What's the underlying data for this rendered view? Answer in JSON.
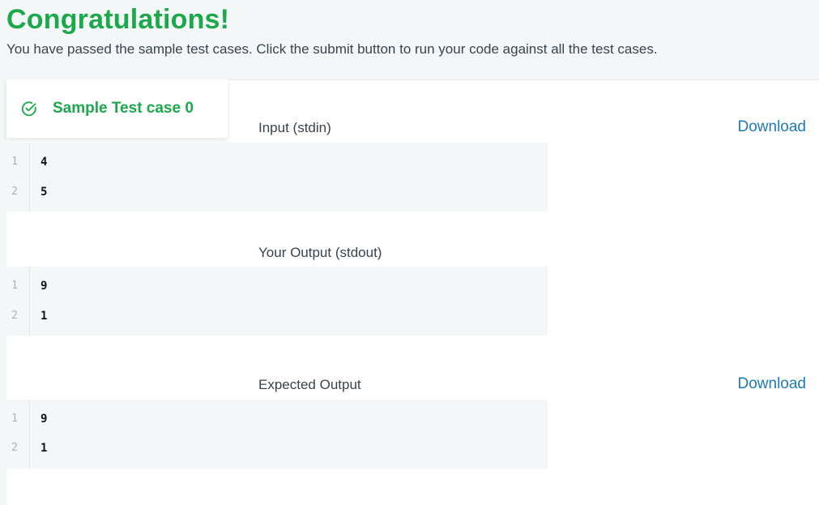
{
  "banner": {
    "title": "Congratulations!",
    "message": "You have passed the sample test cases. Click the submit button to run your code against all the test cases."
  },
  "colors": {
    "success": "#1ba94c",
    "link": "#1f7ab8",
    "text": "#39424e",
    "code_bg": "#f3f7f7"
  },
  "test_cases": [
    {
      "label": "Sample Test case 0",
      "status_icon": "check-circle-icon",
      "status": "passed"
    }
  ],
  "input": {
    "title": "Input (stdin)",
    "download_label": "Download",
    "lines": [
      {
        "no": "1",
        "text": "4"
      },
      {
        "no": "2",
        "text": "5"
      }
    ]
  },
  "your_output": {
    "title": "Your Output (stdout)",
    "lines": [
      {
        "no": "1",
        "text": "9"
      },
      {
        "no": "2",
        "text": "1"
      }
    ]
  },
  "expected_output": {
    "title": "Expected Output",
    "download_label": "Download",
    "lines": [
      {
        "no": "1",
        "text": "9"
      },
      {
        "no": "2",
        "text": "1"
      }
    ]
  }
}
